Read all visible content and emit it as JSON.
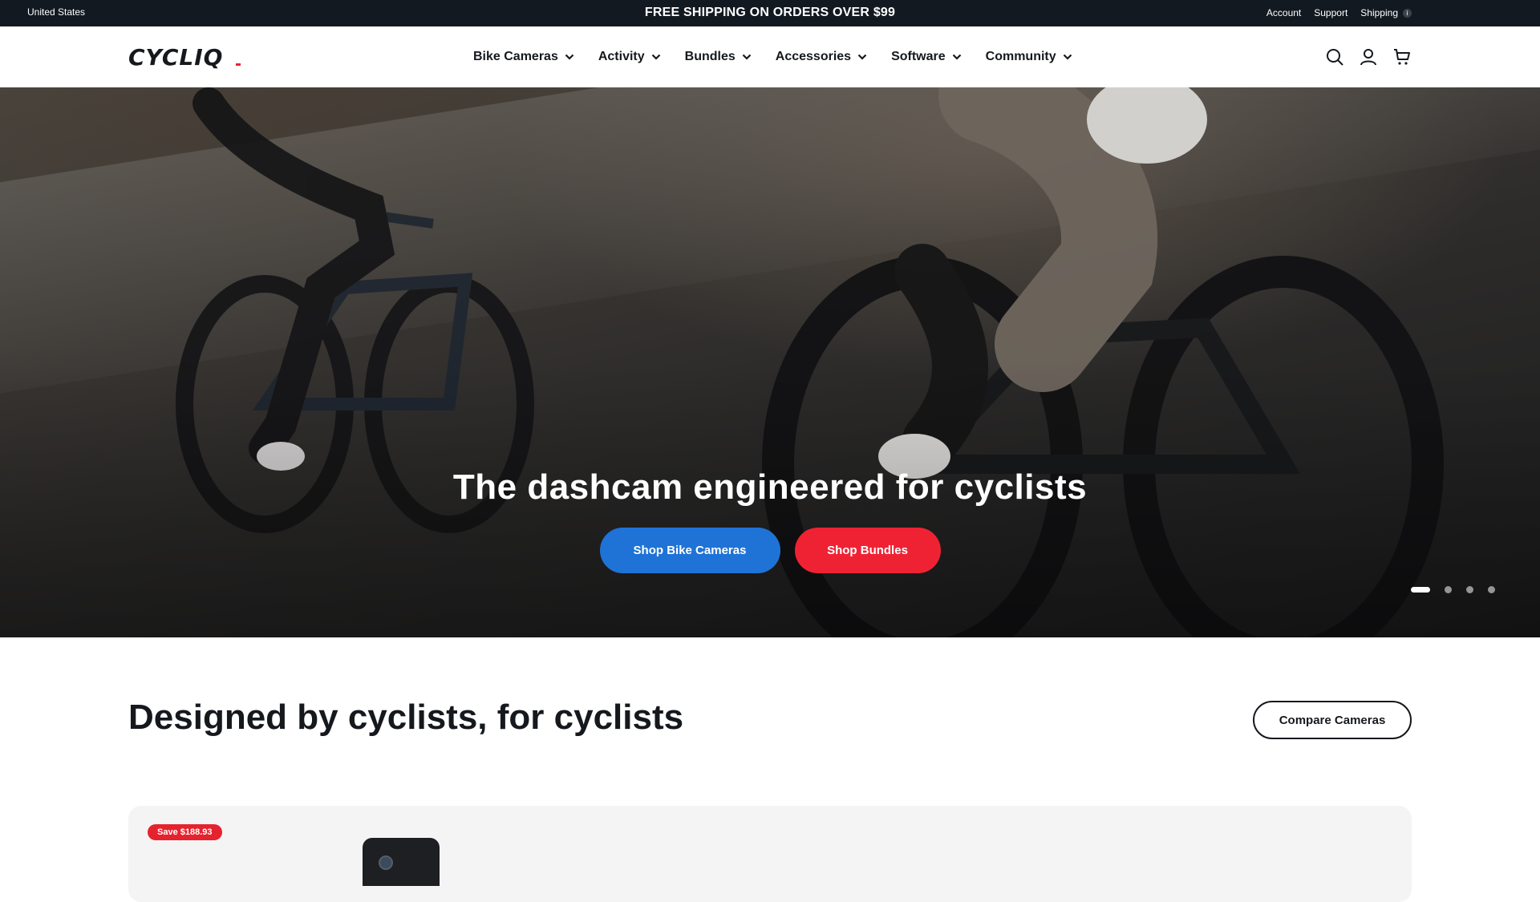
{
  "announcement": {
    "country": "United States",
    "promo": "FREE SHIPPING ON ORDERS OVER $99",
    "links": [
      "Account",
      "Support",
      "Shipping"
    ],
    "info_symbol": "i"
  },
  "header": {
    "logo_text": "CYCLIQ",
    "nav": [
      {
        "label": "Bike Cameras"
      },
      {
        "label": "Activity"
      },
      {
        "label": "Bundles"
      },
      {
        "label": "Accessories"
      },
      {
        "label": "Software"
      },
      {
        "label": "Community"
      }
    ],
    "icons": [
      "search-icon",
      "account-icon",
      "cart-icon"
    ]
  },
  "hero": {
    "title": "The dashcam engineered for cyclists",
    "cta_primary": "Shop Bike Cameras",
    "cta_secondary": "Shop Bundles",
    "slides_count": 4,
    "active_slide": 1
  },
  "section": {
    "title": "Designed by cyclists, for cyclists",
    "compare_label": "Compare Cameras"
  },
  "product": {
    "badge": "Save $188.93"
  },
  "colors": {
    "topbar": "#121920",
    "primary_blue": "#1f73d6",
    "accent_red": "#ef2234",
    "text_dark": "#15191e"
  }
}
